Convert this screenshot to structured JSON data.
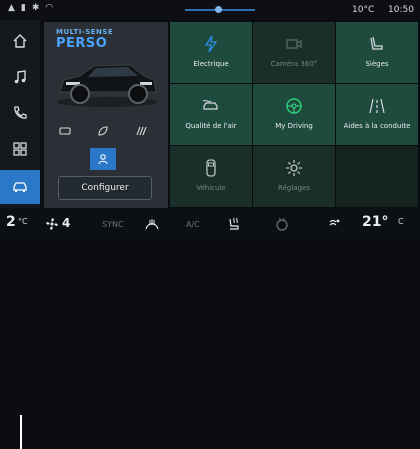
{
  "status": {
    "temperature": "10°C",
    "clock": "10:50"
  },
  "profile": {
    "title_line1": "MULTI-SENSE",
    "title_line2": "PERSO",
    "configure_label": "Configurer"
  },
  "tiles": [
    {
      "label": "Electrique",
      "icon": "lightning-icon",
      "enabled": true
    },
    {
      "label": "Caméra 360°",
      "icon": "camera-icon",
      "enabled": false
    },
    {
      "label": "Sièges",
      "icon": "seat-icon",
      "enabled": true
    },
    {
      "label": "Qualité de l'air",
      "icon": "car-air-icon",
      "enabled": true
    },
    {
      "label": "My Driving",
      "icon": "steering-wheel-icon",
      "enabled": true
    },
    {
      "label": "Aides à la conduite",
      "icon": "lane-assist-icon",
      "enabled": true
    },
    {
      "label": "Véhicule",
      "icon": "vehicle-top-icon",
      "enabled": false
    },
    {
      "label": "Réglages",
      "icon": "gear-icon",
      "enabled": false
    }
  ],
  "climate": {
    "left_temp": "2",
    "left_unit": "°C",
    "fan_level": "4",
    "sync_label": "SYNC",
    "ac_label": "A/C",
    "right_temp": "21°",
    "right_unit": "C"
  },
  "colors": {
    "accent": "#2b78c9",
    "tile": "#1f4a3e",
    "panel": "#2a3035"
  }
}
